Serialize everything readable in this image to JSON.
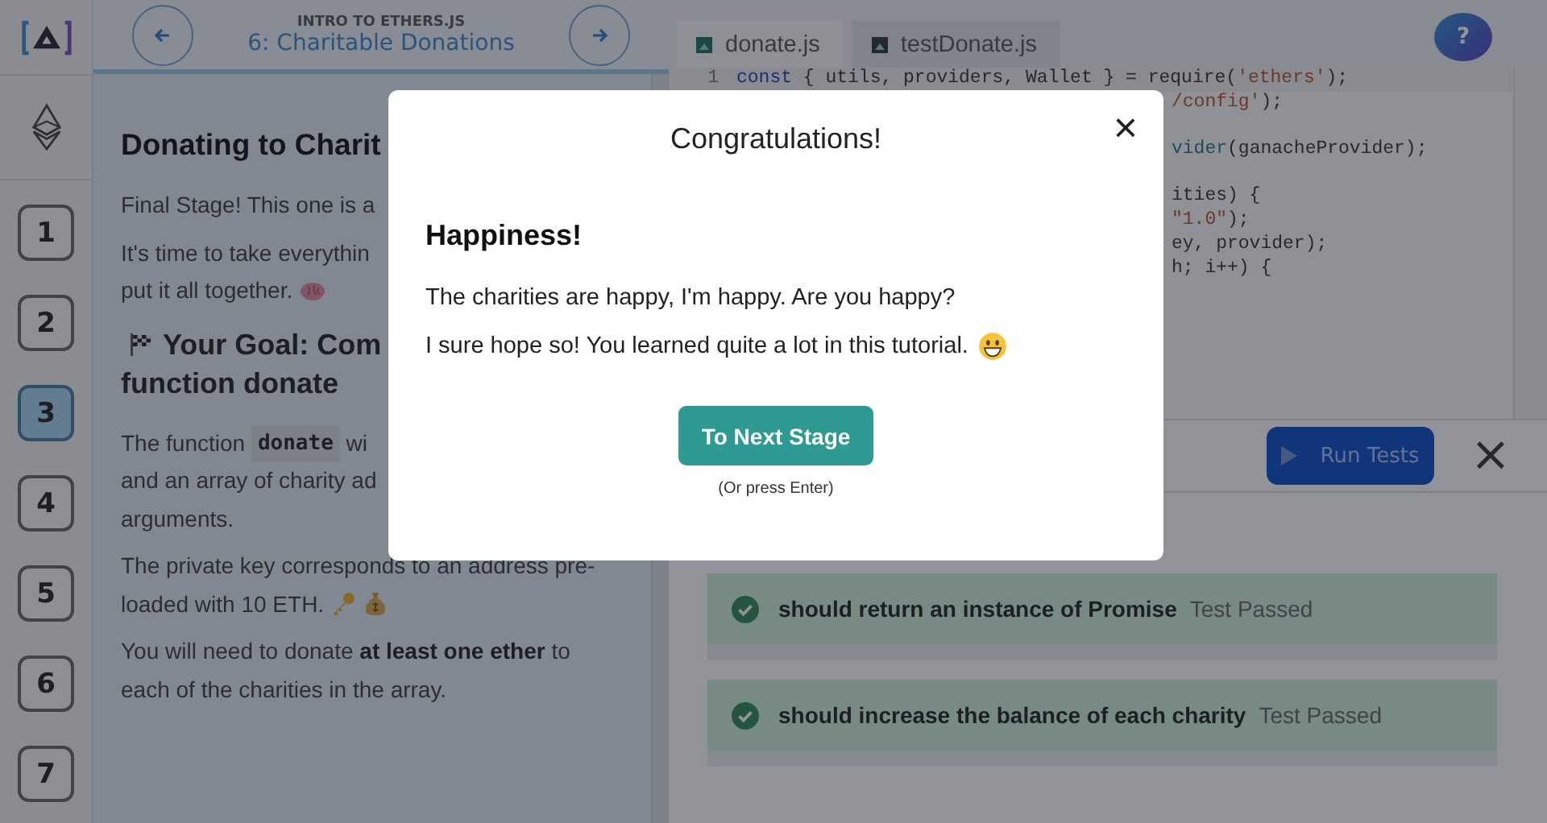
{
  "stages": [
    {
      "label": "1",
      "selected": false
    },
    {
      "label": "2",
      "selected": false
    },
    {
      "label": "3",
      "selected": true
    },
    {
      "label": "4",
      "selected": false
    },
    {
      "label": "5",
      "selected": false
    },
    {
      "label": "6",
      "selected": false
    },
    {
      "label": "7",
      "selected": false
    }
  ],
  "header": {
    "course": "INTRO TO ETHERS.JS",
    "lesson": "6: Charitable Donations"
  },
  "lesson": {
    "title": "Donating to Charit",
    "blocks": [
      {
        "kind": "paragraph",
        "lines": [
          [
            {
              "kind": "text",
              "text": "Final Stage! This one is a"
            }
          ]
        ]
      },
      {
        "kind": "paragraph",
        "lines": [
          [
            {
              "kind": "text",
              "text": "It's time to take everythin"
            }
          ],
          [
            {
              "kind": "text",
              "text": "put it all together."
            },
            {
              "kind": "brain"
            }
          ]
        ]
      },
      {
        "kind": "heading",
        "lines": [
          [
            {
              "kind": "flag"
            },
            {
              "kind": "text",
              "text": "Your Goal: Com"
            }
          ],
          [
            {
              "kind": "text",
              "text": "function donate"
            }
          ]
        ]
      },
      {
        "kind": "paragraph",
        "lines": [
          [
            {
              "kind": "text",
              "text": "The function "
            },
            {
              "kind": "code",
              "text": "donate"
            },
            {
              "kind": "text",
              "text": " wi"
            }
          ],
          [
            {
              "kind": "text",
              "text": "and an array of charity ad"
            }
          ],
          [
            {
              "kind": "text",
              "text": "arguments."
            }
          ]
        ]
      },
      {
        "kind": "paragraph",
        "lines": [
          [
            {
              "kind": "text",
              "text": "The private key corresponds to an address pre-"
            }
          ],
          [
            {
              "kind": "text",
              "text": "loaded with 10 ETH."
            },
            {
              "kind": "key"
            },
            {
              "kind": "moneybag"
            }
          ]
        ]
      },
      {
        "kind": "paragraph",
        "lines": [
          [
            {
              "kind": "text",
              "text": "You will need to donate "
            },
            {
              "kind": "bold",
              "text": "at least one ether"
            },
            {
              "kind": "text",
              "text": " to"
            }
          ],
          [
            {
              "kind": "text",
              "text": "each of the charities in the array."
            }
          ]
        ]
      }
    ]
  },
  "editor": {
    "tabs": [
      {
        "label": "donate.js",
        "selected": true
      },
      {
        "label": "testDonate.js",
        "selected": false
      }
    ],
    "line_number": "1",
    "lines": [
      {
        "kind": "full",
        "segments": [
          {
            "kind": "keyword",
            "text": "const"
          },
          {
            "kind": "plain",
            "text": " { utils, providers, Wallet } = require("
          },
          {
            "kind": "string",
            "text": "'ethers'"
          },
          {
            "kind": "plain",
            "text": ");"
          }
        ]
      },
      {
        "kind": "cut",
        "segments": [
          {
            "kind": "string",
            "text": "/config'"
          },
          {
            "kind": "plain",
            "text": ");"
          }
        ]
      },
      {
        "kind": "blank"
      },
      {
        "kind": "cut",
        "segments": [
          {
            "kind": "call",
            "text": "vider"
          },
          {
            "kind": "plain",
            "text": "(ganacheProvider);"
          }
        ]
      },
      {
        "kind": "blank"
      },
      {
        "kind": "cut",
        "segments": [
          {
            "kind": "plain",
            "text": "ities) {"
          }
        ]
      },
      {
        "kind": "cut",
        "segments": [
          {
            "kind": "string",
            "text": "\"1.0\""
          },
          {
            "kind": "plain",
            "text": ");"
          }
        ]
      },
      {
        "kind": "cut",
        "segments": [
          {
            "kind": "plain",
            "text": "ey, provider);"
          }
        ]
      },
      {
        "kind": "cut",
        "segments": [
          {
            "kind": "plain",
            "text": "h; i++) {"
          }
        ]
      }
    ]
  },
  "help": {
    "label": "?"
  },
  "tests": {
    "run_label": "Run Tests",
    "close": "×",
    "results": [
      {
        "name": "should return an instance of Promise",
        "status": "Test Passed",
        "passed": true
      },
      {
        "name": "should increase the balance of each charity",
        "status": "Test Passed",
        "passed": true
      }
    ]
  },
  "modal": {
    "title": "Congratulations!",
    "close": "×",
    "heading": "Happiness!",
    "paragraphs": [
      {
        "text": "The charities are happy, I'm happy. Are you happy?",
        "emoji": false
      },
      {
        "text": "I sure hope so! You learned quite a lot in this tutorial.",
        "emoji": true
      }
    ],
    "button": "To Next Stage",
    "hint": "(Or press Enter)"
  }
}
